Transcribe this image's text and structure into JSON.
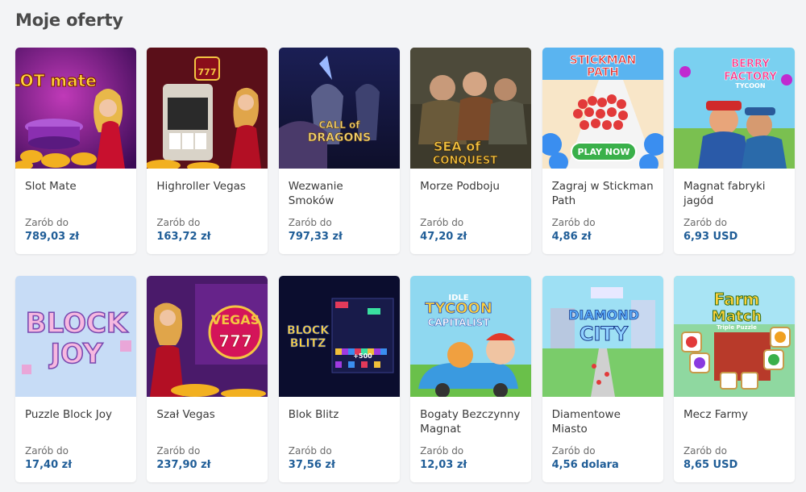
{
  "header": {
    "title": "Moje oferty"
  },
  "offers": [
    {
      "title": "Slot Mate",
      "earn_label": "Zarób do",
      "amount": "789,03 zł",
      "image_icon": "slot-mate-game-icon",
      "logo_text": "SLOT mate"
    },
    {
      "title": "Highroller Vegas",
      "earn_label": "Zarób do",
      "amount": "163,72 zł",
      "image_icon": "highroller-vegas-game-icon",
      "logo_text": "777"
    },
    {
      "title": "Wezwanie Smoków",
      "earn_label": "Zarób do",
      "amount": "797,33 zł",
      "image_icon": "call-of-dragons-game-icon",
      "logo_text": "CALL of DRAGONS"
    },
    {
      "title": "Morze Podboju",
      "earn_label": "Zarób do",
      "amount": "47,20 zł",
      "image_icon": "sea-of-conquest-game-icon",
      "logo_text": "SEA of CONQUEST"
    },
    {
      "title": "Zagraj w Stickman Path",
      "earn_label": "Zarób do",
      "amount": "4,86 zł",
      "image_icon": "stickman-path-game-icon",
      "logo_text": "STICKMAN PATH",
      "button_text": "PLAY NOW"
    },
    {
      "title": "Magnat fabryki jagód",
      "earn_label": "Zarób do",
      "amount": "6,93 USD",
      "image_icon": "berry-factory-game-icon",
      "logo_text": "BERRY FACTORY TYCOON"
    },
    {
      "title": "Puzzle Block Joy",
      "earn_label": "Zarób do",
      "amount": "17,40 zł",
      "image_icon": "block-joy-game-icon",
      "logo_text": "BLOCK JOY"
    },
    {
      "title": "Szał Vegas",
      "earn_label": "Zarób do",
      "amount": "237,90 zł",
      "image_icon": "vegas-craze-game-icon",
      "logo_text": "VEGAS 777"
    },
    {
      "title": "Blok Blitz",
      "earn_label": "Zarób do",
      "amount": "37,56 zł",
      "image_icon": "block-blitz-game-icon",
      "logo_text": "BLOCK BLITZ"
    },
    {
      "title": "Bogaty Bezczynny Magnat",
      "earn_label": "Zarób do",
      "amount": "12,03 zł",
      "image_icon": "idle-tycoon-game-icon",
      "logo_text": "IDLE TYCOON CAPITALIST"
    },
    {
      "title": "Diamentowe Miasto",
      "earn_label": "Zarób do",
      "amount": "4,56 dolara",
      "image_icon": "diamond-city-game-icon",
      "logo_text": "DIAMOND CITY"
    },
    {
      "title": "Mecz Farmy",
      "earn_label": "Zarób do",
      "amount": "8,65 USD",
      "image_icon": "farm-match-game-icon",
      "logo_text": "Farm Match"
    }
  ],
  "colors": {
    "amount": "#1f5d97",
    "background": "#f3f4f6",
    "card": "#ffffff"
  }
}
